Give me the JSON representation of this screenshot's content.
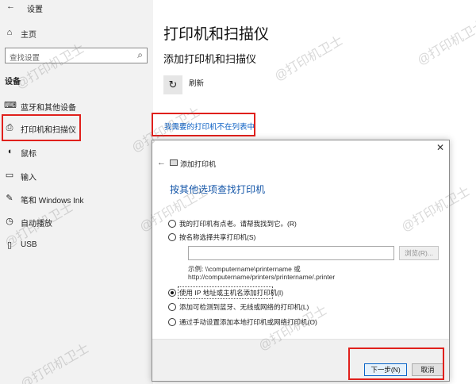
{
  "sidebar": {
    "app_title": "设置",
    "home": "主页",
    "search_placeholder": "查找设置",
    "section_header": "设备",
    "items": [
      {
        "label": "蓝牙和其他设备"
      },
      {
        "label": "打印机和扫描仪"
      },
      {
        "label": "鼠标"
      },
      {
        "label": "输入"
      },
      {
        "label": "笔和 Windows Ink"
      },
      {
        "label": "自动播放"
      },
      {
        "label": "USB"
      }
    ]
  },
  "main": {
    "title": "打印机和扫描仪",
    "subtitle": "添加打印机和扫描仪",
    "refresh_label": "刷新",
    "missing_link": "我需要的打印机不在列表中"
  },
  "dialog": {
    "title": "添加打印机",
    "heading": "按其他选项查找打印机",
    "options": [
      {
        "label": "我的打印机有点老。请帮我找到它。(R)",
        "checked": false
      },
      {
        "label": "按名称选择共享打印机(S)",
        "checked": false
      },
      {
        "label": "使用 IP 地址或主机名添加打印机(I)",
        "checked": true
      },
      {
        "label": "添加可检测到蓝牙、无线或网络的打印机(L)",
        "checked": false
      },
      {
        "label": "通过手动设置添加本地打印机或网络打印机(O)",
        "checked": false
      }
    ],
    "browse_label": "浏览(R)...",
    "example_line1": "示例: \\\\computername\\printername 或",
    "example_line2": "http://computername/printers/printername/.printer",
    "next_label": "下一步(N)",
    "cancel_label": "取消"
  },
  "watermark": "@打印机卫士",
  "colors": {
    "highlight_border": "#e0201c",
    "link": "#0a5fc4",
    "heading": "#1456a8"
  }
}
